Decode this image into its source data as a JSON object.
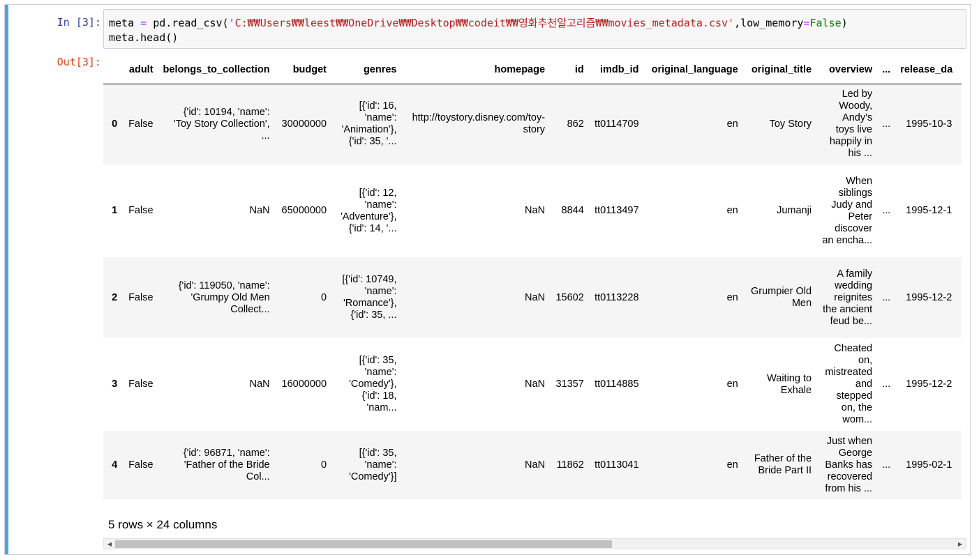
{
  "cell": {
    "in_prompt": "In [3]:",
    "out_prompt": "Out[3]:",
    "code": {
      "line1_a": "meta ",
      "line1_op": "=",
      "line1_b": " pd.read_csv(",
      "line1_str": "'C:₩₩Users₩₩leest₩₩OneDrive₩₩Desktop₩₩codeit₩₩영화추천알고리즘₩₩movies_metadata.csv'",
      "line1_c": ",low_memory",
      "line1_op2": "=",
      "line1_kw": "False",
      "line1_d": ")",
      "line2": "meta.head()"
    }
  },
  "dataframe": {
    "columns": [
      "",
      "adult",
      "belongs_to_collection",
      "budget",
      "genres",
      "homepage",
      "id",
      "imdb_id",
      "original_language",
      "original_title",
      "overview",
      "...",
      "release_da"
    ],
    "rows": [
      {
        "index": "0",
        "adult": "False",
        "belongs_to_collection": "{'id': 10194, 'name': 'Toy Story Collection', ...",
        "budget": "30000000",
        "genres": "[{'id': 16, 'name': 'Animation'}, {'id': 35, '...",
        "homepage": "http://toystory.disney.com/toy-story",
        "id": "862",
        "imdb_id": "tt0114709",
        "original_language": "en",
        "original_title": "Toy Story",
        "overview": "Led by Woody, Andy's toys live happily in his ...",
        "ellipsis": "...",
        "release_date": "1995-10-3"
      },
      {
        "index": "1",
        "adult": "False",
        "belongs_to_collection": "NaN",
        "budget": "65000000",
        "genres": "[{'id': 12, 'name': 'Adventure'}, {'id': 14, '...",
        "homepage": "NaN",
        "id": "8844",
        "imdb_id": "tt0113497",
        "original_language": "en",
        "original_title": "Jumanji",
        "overview": "When siblings Judy and Peter discover an encha...",
        "ellipsis": "...",
        "release_date": "1995-12-1"
      },
      {
        "index": "2",
        "adult": "False",
        "belongs_to_collection": "{'id': 119050, 'name': 'Grumpy Old Men Collect...",
        "budget": "0",
        "genres": "[{'id': 10749, 'name': 'Romance'}, {'id': 35, ...",
        "homepage": "NaN",
        "id": "15602",
        "imdb_id": "tt0113228",
        "original_language": "en",
        "original_title": "Grumpier Old Men",
        "overview": "A family wedding reignites the ancient feud be...",
        "ellipsis": "...",
        "release_date": "1995-12-2"
      },
      {
        "index": "3",
        "adult": "False",
        "belongs_to_collection": "NaN",
        "budget": "16000000",
        "genres": "[{'id': 35, 'name': 'Comedy'}, {'id': 18, 'nam...",
        "homepage": "NaN",
        "id": "31357",
        "imdb_id": "tt0114885",
        "original_language": "en",
        "original_title": "Waiting to Exhale",
        "overview": "Cheated on, mistreated and stepped on, the wom...",
        "ellipsis": "...",
        "release_date": "1995-12-2"
      },
      {
        "index": "4",
        "adult": "False",
        "belongs_to_collection": "{'id': 96871, 'name': 'Father of the Bride Col...",
        "budget": "0",
        "genres": "[{'id': 35, 'name': 'Comedy'}]",
        "homepage": "NaN",
        "id": "11862",
        "imdb_id": "tt0113041",
        "original_language": "en",
        "original_title": "Father of the Bride Part II",
        "overview": "Just when George Banks has recovered from his ...",
        "ellipsis": "...",
        "release_date": "1995-02-1"
      }
    ],
    "summary": "5 rows × 24 columns"
  },
  "scrollbar": {
    "left_arrow_icon": "triangle-left-icon",
    "right_arrow_icon": "triangle-right-icon",
    "left_glyph": "◀",
    "right_glyph": "▶"
  },
  "colors": {
    "cell_bar": "#42a5f5",
    "in_prompt": "#303f9f",
    "out_prompt": "#d84315",
    "string": "#ba2121",
    "keyword": "#008000",
    "operator": "#aa22ff"
  }
}
